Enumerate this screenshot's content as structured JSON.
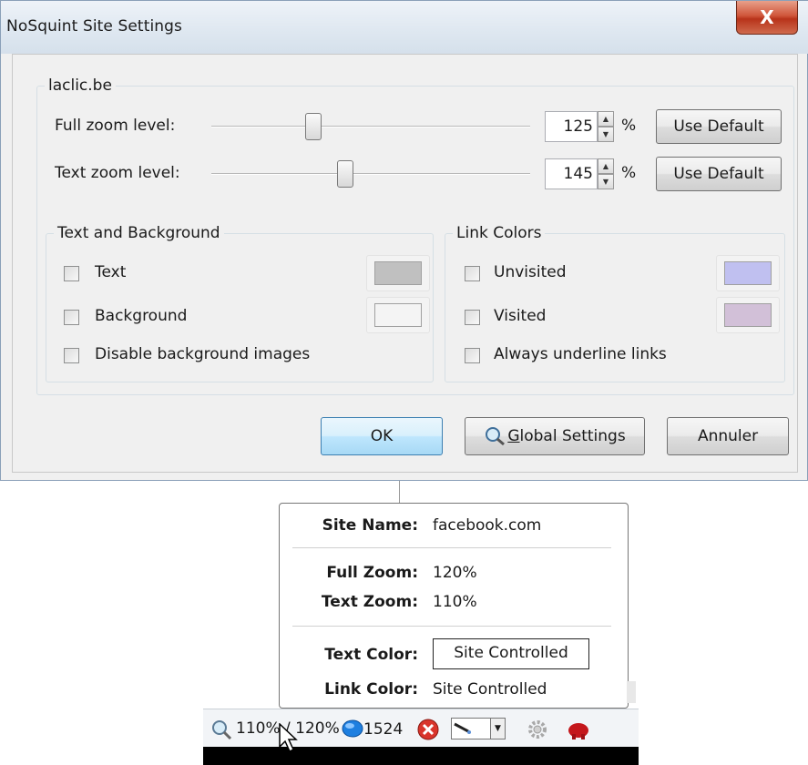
{
  "dialog": {
    "title": "NoSquint Site Settings",
    "close_label": "X",
    "site": "laclic.be",
    "full_zoom": {
      "label": "Full zoom level:",
      "value": "125",
      "unit": "%",
      "slider_fraction": 0.32,
      "default_label": "Use Default"
    },
    "text_zoom": {
      "label": "Text zoom level:",
      "value": "145",
      "unit": "%",
      "slider_fraction": 0.42,
      "default_label": "Use Default"
    },
    "text_bg": {
      "legend": "Text and Background",
      "text_label": "Text",
      "text_color": "#c0c0c0",
      "background_label": "Background",
      "background_color": "#f4f4f4",
      "disable_images_label": "Disable background images"
    },
    "link_colors": {
      "legend": "Link Colors",
      "unvisited_label": "Unvisited",
      "unvisited_color": "#c0c0f0",
      "visited_label": "Visited",
      "visited_color": "#d2c0d8",
      "underline_label": "Always underline links"
    },
    "buttons": {
      "ok": "OK",
      "global_prefix": "G",
      "global_rest": "lobal Settings",
      "cancel": "Annuler"
    }
  },
  "tooltip": {
    "site_name_key": "Site Name:",
    "site_name_val": "facebook.com",
    "full_zoom_key": "Full Zoom:",
    "full_zoom_val": "120%",
    "text_zoom_key": "Text Zoom:",
    "text_zoom_val": "110%",
    "text_color_key": "Text Color:",
    "text_color_val": "Site Controlled",
    "link_color_key": "Link Color:",
    "link_color_val": "Site Controlled"
  },
  "statusbar": {
    "zoom_text": "110% / 120%",
    "count": "1524",
    "icons": [
      "magnifier-icon",
      "chat-bubble-icon",
      "error-icon",
      "eyedropper-icon",
      "gear-icon",
      "red-icon"
    ]
  }
}
